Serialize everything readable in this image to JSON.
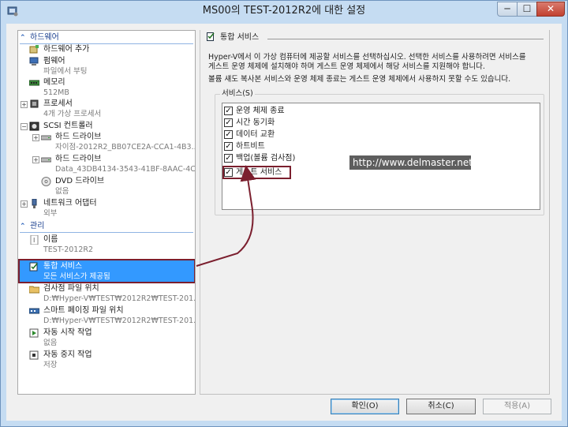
{
  "window": {
    "title": "MS00의 TEST-2012R2에 대한 설정",
    "min_label": "─",
    "max_label": "☐",
    "close_label": "✕"
  },
  "tree": {
    "hardware_header": "하드웨어",
    "items_hw": [
      {
        "label": "하드웨어 추가",
        "sub": ""
      },
      {
        "label": "펌웨어",
        "sub": "파일에서 부팅"
      },
      {
        "label": "메모리",
        "sub": "512MB"
      },
      {
        "label": "프로세서",
        "sub": "4개 가상 프로세서"
      },
      {
        "label": "SCSI 컨트롤러",
        "sub": ""
      },
      {
        "label": "하드 드라이브",
        "sub": "자이점-2012R2_BB07CE2A-CCA1-4B3..."
      },
      {
        "label": "하드 드라이브",
        "sub": "Data_43DB4134-3543-41BF-8AAC-4C..."
      },
      {
        "label": "DVD 드라이브",
        "sub": "없음"
      },
      {
        "label": "네트워크 어댑터",
        "sub": "외부"
      }
    ],
    "management_header": "관리",
    "items_mgmt": [
      {
        "label": "이름",
        "sub": "TEST-2012R2"
      },
      {
        "label": "통합 서비스",
        "sub": "모든 서비스가 제공됨"
      },
      {
        "label": "검사점 파일 위치",
        "sub": "D:₩Hyper-V₩TEST₩2012R2₩TEST-201..."
      },
      {
        "label": "스마트 페이징 파일 위치",
        "sub": "D:₩Hyper-V₩TEST₩2012R2₩TEST-201..."
      },
      {
        "label": "자동 시작 작업",
        "sub": "없음"
      },
      {
        "label": "자동 중지 작업",
        "sub": "저장"
      }
    ]
  },
  "panel": {
    "header": "통합 서비스",
    "desc1_line1": "Hyper-V에서 이 가상 컴퓨터에 제공할 서비스를 선택하십시오. 선택한 서비스를 사용하려면 서비스를",
    "desc1_line2": "게스트 운영 체제에 설치해야 하며 게스트 운영 체제에서 해당 서비스를 지원해야 합니다.",
    "desc2": "볼륨 섀도 복사본 서비스와 운영 체제 종료는 게스트 운영 체제에서 사용하지 못할 수도 있습니다.",
    "group_title": "서비스(S)",
    "services": [
      {
        "label": "운영 체제 종료",
        "checked": true
      },
      {
        "label": "시간 동기화",
        "checked": true
      },
      {
        "label": "데이터 교환",
        "checked": true
      },
      {
        "label": "하트비트",
        "checked": true
      },
      {
        "label": "백업(볼륨 검사점)",
        "checked": true
      },
      {
        "label": "게스트 서비스",
        "checked": true
      }
    ],
    "check_mark": "✓"
  },
  "watermark": "http://www.delmaster.net",
  "buttons": {
    "ok": "확인(O)",
    "cancel": "취소(C)",
    "apply": "적용(A)"
  },
  "colors": {
    "selection": "#3399ff",
    "highlight_box": "#7b1f2e",
    "section_header": "#1a3f8f"
  }
}
